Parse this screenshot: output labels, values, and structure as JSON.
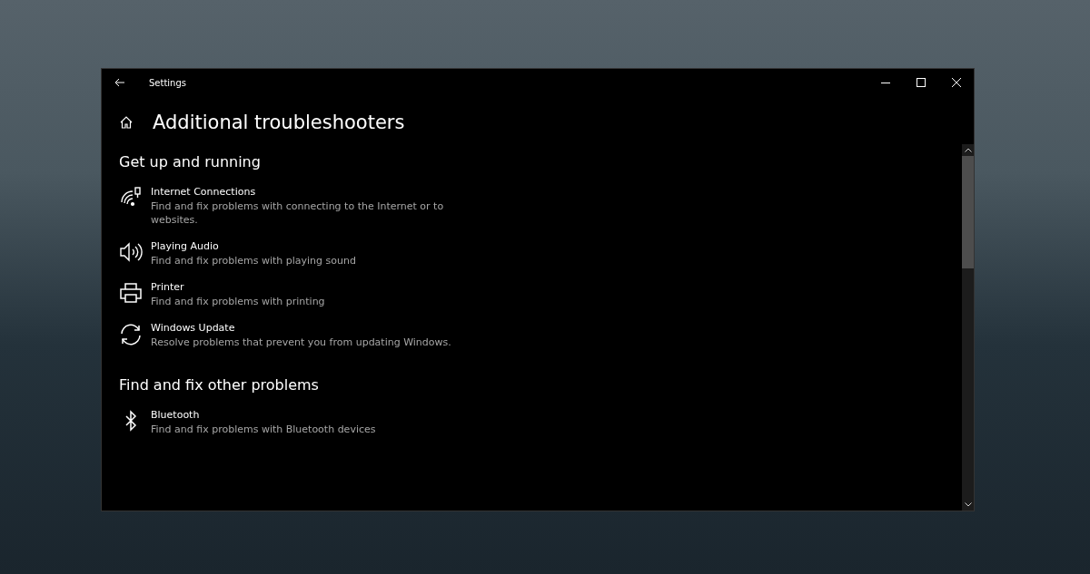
{
  "window": {
    "title": "Settings"
  },
  "page_title": "Additional troubleshooters",
  "sections": [
    {
      "heading": "Get up and running",
      "items": [
        {
          "kind": "network",
          "title": "Internet Connections",
          "description": "Find and fix problems with connecting to the Internet or to websites."
        },
        {
          "kind": "audio",
          "title": "Playing Audio",
          "description": "Find and fix problems with playing sound"
        },
        {
          "kind": "printer",
          "title": "Printer",
          "description": "Find and fix problems with printing"
        },
        {
          "kind": "update",
          "title": "Windows Update",
          "description": "Resolve problems that prevent you from updating Windows."
        }
      ]
    },
    {
      "heading": "Find and fix other problems",
      "items": [
        {
          "kind": "bluetooth",
          "title": "Bluetooth",
          "description": "Find and fix problems with Bluetooth devices"
        }
      ]
    }
  ]
}
